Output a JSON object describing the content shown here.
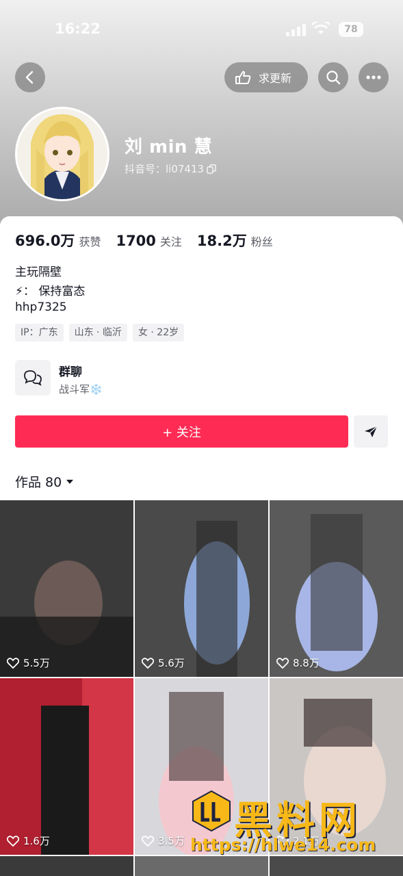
{
  "status_bar": {
    "time": "16:22",
    "battery": "78"
  },
  "header": {
    "update_button_label": "求更新"
  },
  "profile": {
    "name": "刘 min 慧",
    "douyin_id": "抖音号：li07413",
    "stats": [
      {
        "value": "696.0万",
        "label": "获赞"
      },
      {
        "value": "1700",
        "label": "关注"
      },
      {
        "value": "18.2万",
        "label": "粉丝"
      }
    ],
    "bio_lines": [
      "主玩隔壁",
      "⚡：  保持富态",
      "hhp7325"
    ],
    "tags": [
      "IP：广东",
      "山东 · 临沂",
      "女 · 22岁"
    ]
  },
  "group_chat": {
    "title": "群聊",
    "subtitle": "战斗军❄️"
  },
  "actions": {
    "follow_label": "+ 关注"
  },
  "works": {
    "tab_label": "作品 80",
    "items": [
      {
        "likes": "5.5万",
        "colors": [
          "#3a3a3a",
          "#6b5a55",
          "#1d1d1d"
        ]
      },
      {
        "likes": "5.6万",
        "colors": [
          "#4a4a4a",
          "#8da8d8",
          "#2a2a2a"
        ]
      },
      {
        "likes": "8.8万",
        "colors": [
          "#5a5a5a",
          "#a7b6e6",
          "#373737"
        ]
      },
      {
        "likes": "1.6万",
        "colors": [
          "#b02030",
          "#e24050",
          "#1a1a1a"
        ]
      },
      {
        "likes": "3.5万",
        "colors": [
          "#d8d8dc",
          "#f3c8cf",
          "#5a4a4a"
        ]
      },
      {
        "likes": "2.1万",
        "colors": [
          "#c9c6c4",
          "#e8d8d0",
          "#3e3232"
        ]
      }
    ]
  },
  "watermark": {
    "text": "黑料网",
    "url": "https://hlwe14.com"
  },
  "accent_color": "#fe2c55"
}
